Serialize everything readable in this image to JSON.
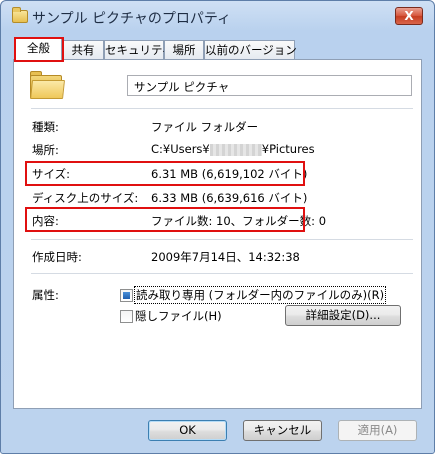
{
  "window": {
    "title": "サンプル ピクチャのプロパティ",
    "close_label": "X"
  },
  "tabs": [
    {
      "label": "全般"
    },
    {
      "label": "共有"
    },
    {
      "label": "セキュリティ"
    },
    {
      "label": "場所"
    },
    {
      "label": "以前のバージョン"
    }
  ],
  "general": {
    "name_value": "サンプル ピクチャ",
    "type_label": "種類:",
    "type_value": "ファイル フォルダー",
    "location_label": "場所:",
    "location_prefix": "C:¥Users¥",
    "location_suffix": "¥Pictures",
    "size_label": "サイズ:",
    "size_value": "6.31 MB (6,619,102 バイト)",
    "disk_size_label": "ディスク上のサイズ:",
    "disk_size_value": "6.33 MB (6,639,616 バイト)",
    "contents_label": "内容:",
    "contents_value": "ファイル数: 10、フォルダー数: 0",
    "created_label": "作成日時:",
    "created_value": "2009年7月14日、14:32:38",
    "attributes_label": "属性:",
    "readonly_label": "読み取り専用 (フォルダー内のファイルのみ)(R)",
    "hidden_label": "隠しファイル(H)",
    "advanced_button": "詳細設定(D)..."
  },
  "buttons": {
    "ok": "OK",
    "cancel": "キャンセル",
    "apply": "適用(A)"
  },
  "colors": {
    "highlight": "#e01010",
    "window_frame": "#bcd3ee"
  }
}
